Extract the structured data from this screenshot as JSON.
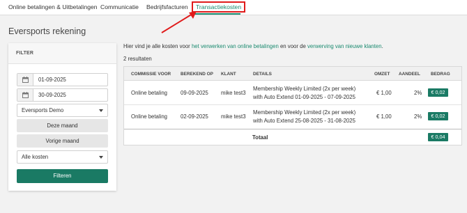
{
  "nav": {
    "tabs": [
      {
        "label": "Online betalingen & Uitbetalingen"
      },
      {
        "label": "Communicatie"
      },
      {
        "label": "Bedrijfsfacturen"
      },
      {
        "label": "Transactiekosten"
      }
    ],
    "active_tab_index": 3
  },
  "page": {
    "title": "Eversports rekening"
  },
  "filter": {
    "heading": "FILTER",
    "date_from": "01-09-2025",
    "date_to": "30-09-2025",
    "account": "Eversports Demo",
    "this_month_label": "Deze maand",
    "previous_month_label": "Vorige maand",
    "cost_type": "Alle kosten",
    "submit_label": "Filteren"
  },
  "intro": {
    "part1": "Hier vind je alle kosten voor ",
    "link1": "het verwerken van online betalingen",
    "part2": " en voor de ",
    "link2": "verwerving van nieuwe klanten",
    "part3": "."
  },
  "result_count": "2 resultaten",
  "table": {
    "columns": [
      "COMMISSIE VOOR",
      "BEREKEND OP",
      "KLANT",
      "DETAILS",
      "OMZET",
      "AANDEEL",
      "BEDRAG"
    ],
    "rows": [
      {
        "commission_for": "Online betaling",
        "calculated_on": "09-09-2025",
        "customer": "mike test3",
        "details_line1": "Membership Weekly Limited (2x per week)",
        "details_line2": "with Auto Extend 01-09-2025 - 07-09-2025",
        "revenue": "€ 1,00",
        "share": "2%",
        "amount": "€ 0,02"
      },
      {
        "commission_for": "Online betaling",
        "calculated_on": "02-09-2025",
        "customer": "mike test3",
        "details_line1": "Membership Weekly Limited (2x per week)",
        "details_line2": "with Auto Extend 25-08-2025 - 31-08-2025",
        "revenue": "€ 1,00",
        "share": "2%",
        "amount": "€ 0,02"
      }
    ],
    "total_label": "Totaal",
    "total_amount": "€ 0,04"
  },
  "colors": {
    "accent": "#1a8a6f",
    "button": "#1a7a64",
    "highlight": "#e01b1b"
  },
  "icons": {
    "calendar": "calendar-icon",
    "dropdown": "chevron-down-icon",
    "annotation": "red-arrow-icon"
  }
}
